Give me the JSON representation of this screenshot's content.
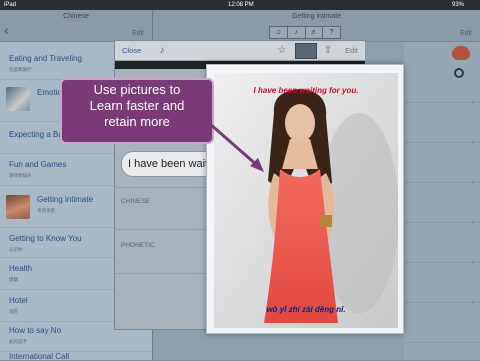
{
  "status": {
    "carrier": "iPad",
    "time": "12:08 PM",
    "battery": "93%"
  },
  "left_pane": {
    "title": "Chinese",
    "edit_label": "Edit",
    "categories": [
      {
        "en": "Eating and Traveling",
        "zh": "吃饭和旅行"
      },
      {
        "en": "Emotions",
        "zh": ""
      },
      {
        "en": "Expecting a Baby",
        "zh": ""
      },
      {
        "en": "Fun and Games",
        "zh": "游戏和娱乐"
      },
      {
        "en": "Getting intimate",
        "zh": "亲热亲密"
      },
      {
        "en": "Getting to Know You",
        "zh": "认识你"
      },
      {
        "en": "Health",
        "zh": "健康"
      },
      {
        "en": "Hotel",
        "zh": "酒店"
      },
      {
        "en": "How to say No",
        "zh": "如何说不"
      },
      {
        "en": "International Call",
        "zh": ""
      }
    ]
  },
  "right_pane": {
    "title": "Getting intimate",
    "edit_label": "Edit"
  },
  "card": {
    "close_label": "Close",
    "edit_label": "Edit",
    "phrase": "I have been waiting for you.",
    "chinese_label": "CHINESE",
    "phonetic_label": "PHONETIC"
  },
  "photo": {
    "caption": "I have been waiting for you.",
    "phonetic": "wǒ yī zhí zài děng nǐ."
  },
  "callout": {
    "line1": "Use pictures to",
    "line2": "Learn faster and",
    "line3": "retain more"
  },
  "colors": {
    "accent": "#1f5fb0",
    "callout_bg": "#7a3a77",
    "caption": "#d0102a",
    "phonetic": "#0b1e8a"
  },
  "icons": [
    "back-arrow-icon",
    "star-icon",
    "share-icon",
    "photo-icon",
    "search-icon",
    "brain-icon",
    "speaker-icon",
    "question-icon"
  ]
}
